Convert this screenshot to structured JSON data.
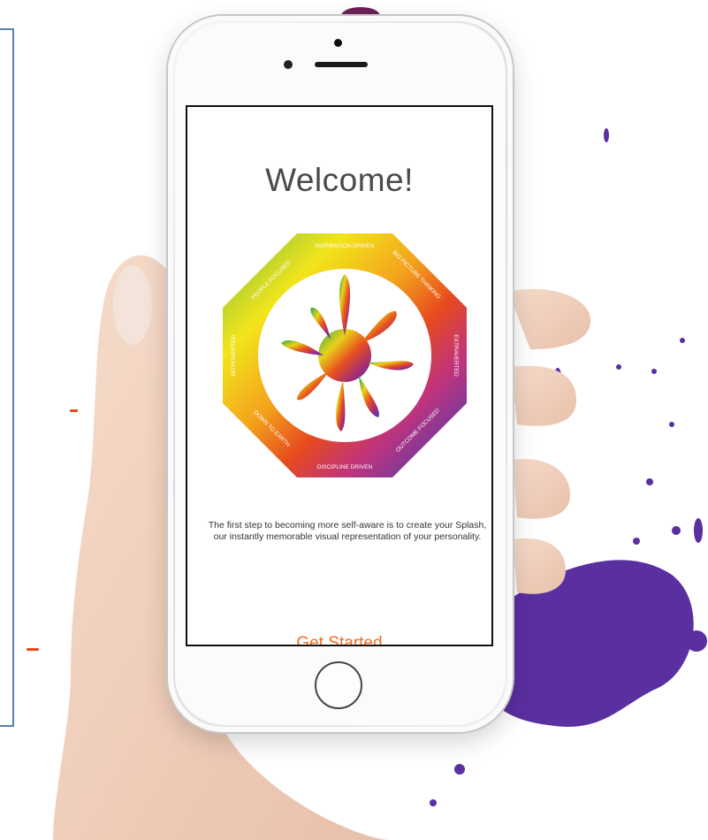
{
  "screen": {
    "title": "Welcome!",
    "description": "The first step to becoming more self-aware is to create your Splash, our instantly memorable visual representation of your personality.",
    "cta_label": "Get Started"
  },
  "wheel_labels": [
    "INSPIRATION DRIVEN",
    "BIG PICTURE THINKING",
    "EXTRAVERTED",
    "OUTCOME FOCUSED",
    "DISCIPLINE DRIVEN",
    "DOWN TO EARTH",
    "INTROVERTED",
    "PEOPLE FOCUSED"
  ],
  "colors": {
    "accent": "#f26b1f",
    "frame": "#5b7fb3",
    "splash_purple": "#5a2fa0"
  },
  "icons": [
    "front-camera-icon",
    "speaker-grille-icon",
    "home-button-icon",
    "splash-logo-icon"
  ]
}
